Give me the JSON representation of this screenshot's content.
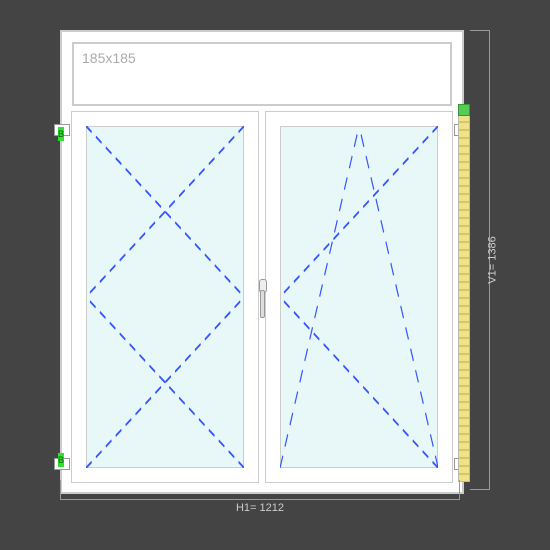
{
  "top_panel": {
    "size_label": "185x185"
  },
  "dimensions": {
    "horizontal_label": "H1= 1212",
    "vertical_label": "V1= 1386"
  },
  "hinge_marker": "B",
  "chart_data": {
    "type": "diagram",
    "object": "double-casement window with transom",
    "overall_width_mm": 1212,
    "overall_height_mm": 1386,
    "top_fixed_panel_mm": [
      185,
      185
    ],
    "sashes": [
      {
        "position": "left",
        "opening": "turn",
        "hinge_side": "left"
      },
      {
        "position": "right",
        "opening": "tilt-and-turn",
        "hinge_side": "right"
      }
    ],
    "handle_position": "center-mullion",
    "accessories": [
      "right-side blind/shutter rail"
    ]
  }
}
